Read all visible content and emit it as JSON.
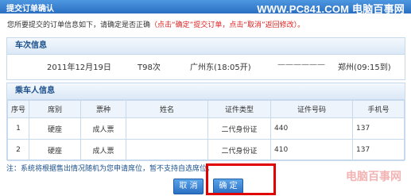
{
  "header": {
    "title": "提交订单确认",
    "watermark": "WWW.PC841.COM 电脑百事网"
  },
  "notice": {
    "prefix": "您所要提交的订单信息如下，请确定是否正确",
    "hint": "（点击“确定”提交订单，点击“取消”返回修改）。"
  },
  "train": {
    "section_title": "车次信息",
    "date": "2011年12月19日",
    "train_no": "T98次",
    "from": "广州东(18:05开)",
    "arrow": "——————",
    "to": "郑州(09:15到)"
  },
  "passenger": {
    "section_title": "乘车人信息",
    "columns": [
      "序号",
      "席别",
      "票种",
      "姓名",
      "证件类型",
      "证件号码",
      "手机号"
    ],
    "rows": [
      [
        "1",
        "硬座",
        "成人票",
        "",
        "二代身份证",
        "440",
        "137"
      ],
      [
        "2",
        "硬座",
        "成人票",
        "",
        "二代身份证",
        "410",
        "137"
      ]
    ]
  },
  "note": "注：系统将根据售出情况随机为您申请席位，暂不支持自选席位。",
  "buttons": {
    "cancel": "取 消",
    "confirm": "确 定"
  },
  "corner_logo": "电脑百事网",
  "colors": {
    "accent": "#2a6fc2",
    "highlight": "#e00000"
  }
}
